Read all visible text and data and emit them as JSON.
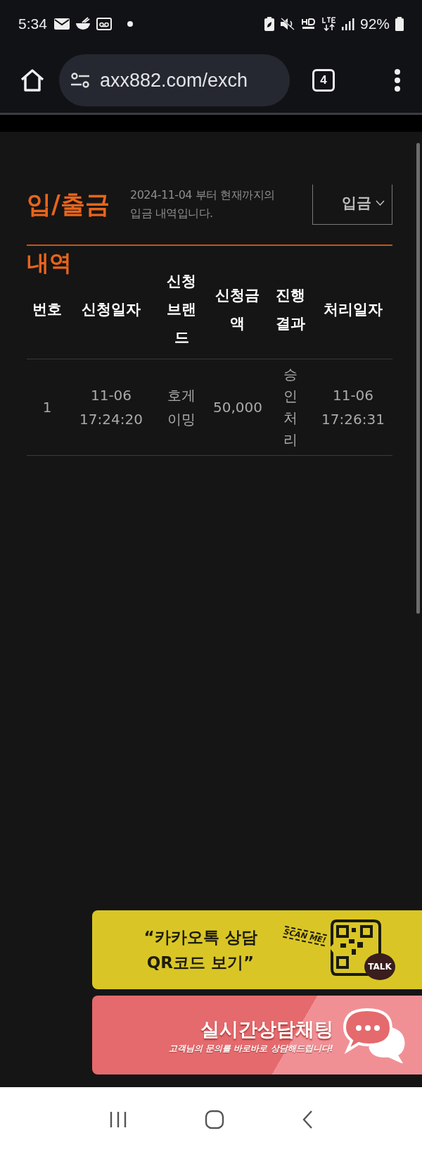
{
  "status_bar": {
    "time": "5:34",
    "battery": "92%"
  },
  "browser": {
    "url": "axx882.com/exch",
    "tab_count": "4"
  },
  "page": {
    "title": "입/출금",
    "description": "2024-11-04 부터 현재까지의 입금 내역입니다.",
    "filter": "입금",
    "section_title": "내역"
  },
  "table": {
    "columns": [
      "번호",
      "신청일자",
      "신청브랜드",
      "신청금액",
      "진행결과",
      "처리일자"
    ],
    "rows": [
      [
        "1",
        "11-06 17:24:20",
        "호게이밍",
        "50,000",
        "승인처리",
        "11-06 17:26:31"
      ]
    ]
  },
  "banners": [
    {
      "kind": "kakao",
      "lines": [
        "“카카오톡 상담",
        "QR코드 보기”"
      ],
      "stamp": "SCAN ME!",
      "badge": "TALK"
    },
    {
      "kind": "chat",
      "title": "실시간상담채팅",
      "subtitle": "고객님의 문의를 바로바로 상담해드립니다!"
    }
  ]
}
